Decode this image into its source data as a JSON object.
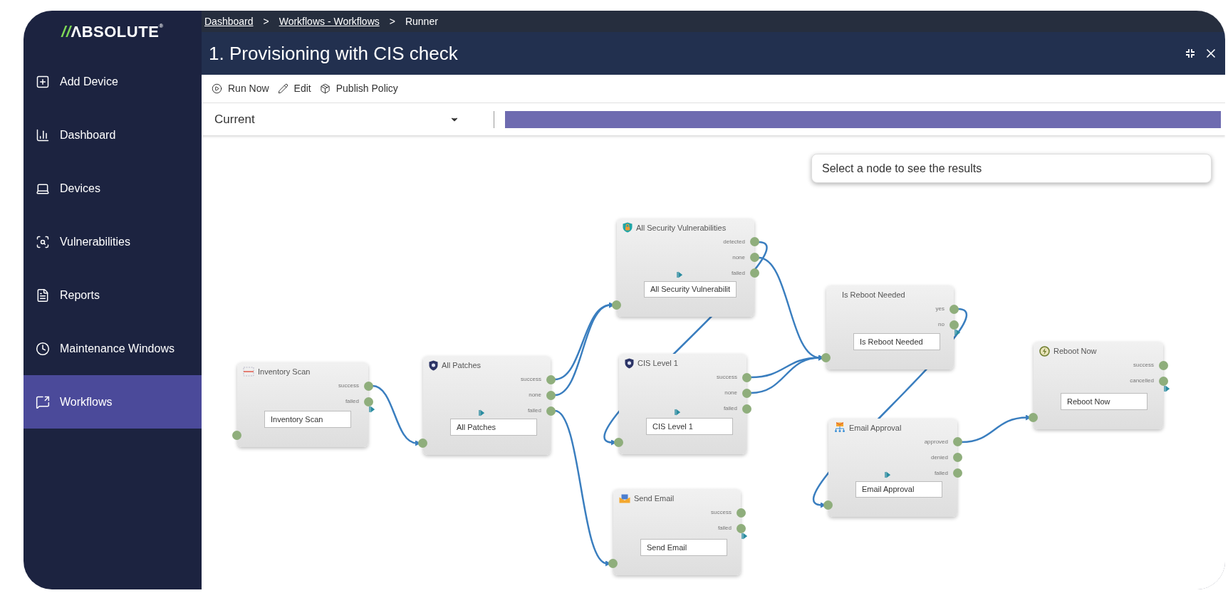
{
  "sidebar": {
    "logo": {
      "mark": "//",
      "text": "ΛBSOLUTE",
      "registered": "®"
    },
    "items": [
      {
        "label": "Add Device",
        "selected": false
      },
      {
        "label": "Dashboard",
        "selected": false
      },
      {
        "label": "Devices",
        "selected": false
      },
      {
        "label": "Vulnerabilities",
        "selected": false
      },
      {
        "label": "Reports",
        "selected": false
      },
      {
        "label": "Maintenance Windows",
        "selected": false
      },
      {
        "label": "Workflows",
        "selected": true
      }
    ]
  },
  "breadcrumb": [
    {
      "label": "Dashboard",
      "kind": "link"
    },
    {
      "label": ">",
      "kind": "separator"
    },
    {
      "label": "Workflows - Workflows",
      "kind": "link"
    },
    {
      "label": ">",
      "kind": "separator"
    },
    {
      "label": "Runner",
      "kind": "current"
    }
  ],
  "title": "1. Provisioning with CIS check",
  "toolbar": [
    {
      "label": "Run Now"
    },
    {
      "label": "Edit"
    },
    {
      "label": "Publish Policy"
    }
  ],
  "version_select": {
    "value": "Current"
  },
  "progress": {
    "level": 1
  },
  "canvas": {
    "hint": "Select a node to see the results",
    "nodes": [
      {
        "title": "Inventory Scan",
        "ports": [
          "success",
          "failed"
        ],
        "field_value": "Inventory Scan"
      },
      {
        "title": "All Patches",
        "ports": [
          "success",
          "none",
          "failed"
        ],
        "field_value": "All Patches"
      },
      {
        "title": "All Security Vulnerabilities",
        "ports": [
          "detected",
          "none",
          "failed"
        ],
        "field_value": "All Security Vulnerabilit"
      },
      {
        "title": "CIS Level 1",
        "ports": [
          "success",
          "none",
          "failed"
        ],
        "field_value": "CIS Level 1"
      },
      {
        "title": "Send Email",
        "ports": [
          "success",
          "failed"
        ],
        "field_value": "Send Email"
      },
      {
        "title": "Is Reboot Needed",
        "ports": [
          "yes",
          "no"
        ],
        "field_value": "Is Reboot Needed"
      },
      {
        "title": "Email Approval",
        "ports": [
          "approved",
          "denied",
          "failed"
        ],
        "field_value": "Email Approval"
      },
      {
        "title": "Reboot Now",
        "ports": [
          "success",
          "cancelled"
        ],
        "field_value": "Reboot Now"
      }
    ]
  }
}
